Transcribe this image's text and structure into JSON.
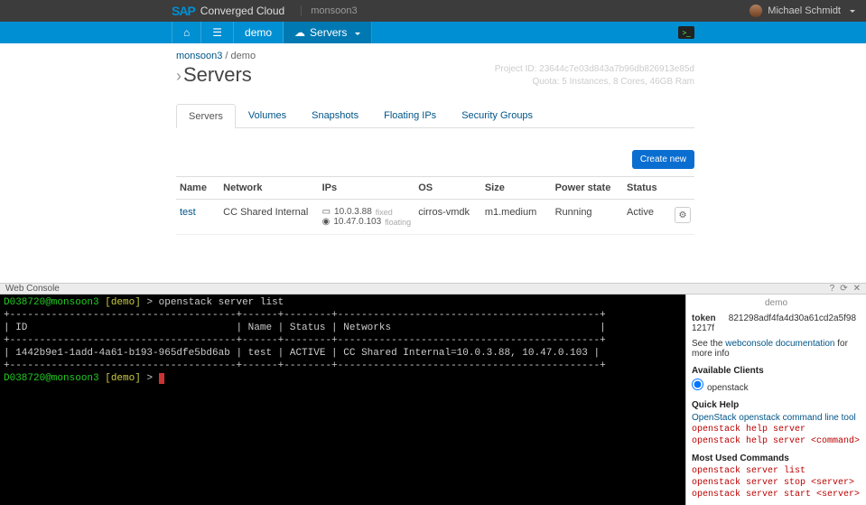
{
  "topbar": {
    "brand_prefix": "SAP",
    "brand_title": "Converged Cloud",
    "env": "monsoon3",
    "user_name": "Michael Schmidt"
  },
  "nav": {
    "items": [
      {
        "label": "",
        "icon": "home-icon"
      },
      {
        "label": "",
        "icon": "list-icon"
      },
      {
        "label": "demo",
        "icon": ""
      },
      {
        "label": "Servers",
        "icon": "cloud-icon",
        "caret": true,
        "active": true
      }
    ]
  },
  "breadcrumb": {
    "parent": "monsoon3",
    "current": "demo"
  },
  "page_title": "Servers",
  "project_meta": {
    "id_line": "Project ID: 23644c7e03d843a7b96db826913e85d",
    "quota_line": "Quota: 5 Instances, 8 Cores, 46GB Ram"
  },
  "tabs": [
    "Servers",
    "Volumes",
    "Snapshots",
    "Floating IPs",
    "Security Groups"
  ],
  "active_tab": 0,
  "create_button": "Create new",
  "table": {
    "headers": [
      "Name",
      "Network",
      "IPs",
      "OS",
      "Size",
      "Power state",
      "Status",
      ""
    ],
    "rows": [
      {
        "name": "test",
        "network": "CC Shared Internal",
        "ips": [
          {
            "addr": "10.0.3.88",
            "tag": "fixed",
            "kind": "nic"
          },
          {
            "addr": "10.47.0.103",
            "tag": "floating",
            "kind": "globe"
          }
        ],
        "os": "cirros-vmdk",
        "size": "m1.medium",
        "power": "Running",
        "status": "Active"
      }
    ]
  },
  "console": {
    "title": "Web Console",
    "prompt_user": "D038720@monsoon3",
    "prompt_ctx": "[demo]",
    "cmd1": "openstack server list",
    "table_header": "| ID                                   | Name | Status | Networks                                   |",
    "table_sep": "+--------------------------------------+------+--------+--------------------------------------------+",
    "table_row": "| 1442b9e1-1add-4a61-b193-965dfe5bd6ab | test | ACTIVE | CC Shared Internal=10.0.3.88, 10.47.0.103 |"
  },
  "side": {
    "demo_label": "demo",
    "token_label": "token",
    "token_value": "821298adf4fa4d30a61cd2a5f981217f",
    "doc_prefix": "See the ",
    "doc_link": "webconsole documentation",
    "doc_suffix": " for more info",
    "avail_title": "Available Clients",
    "avail_client": "openstack",
    "quick_title": "Quick Help",
    "quick_link": "OpenStack openstack command line tool",
    "quick_cmds": [
      "openstack help server",
      "openstack help server <command>"
    ],
    "most_title": "Most Used Commands",
    "most_cmds": [
      "openstack server list",
      "openstack server stop <server>",
      "openstack server start <server>"
    ]
  }
}
